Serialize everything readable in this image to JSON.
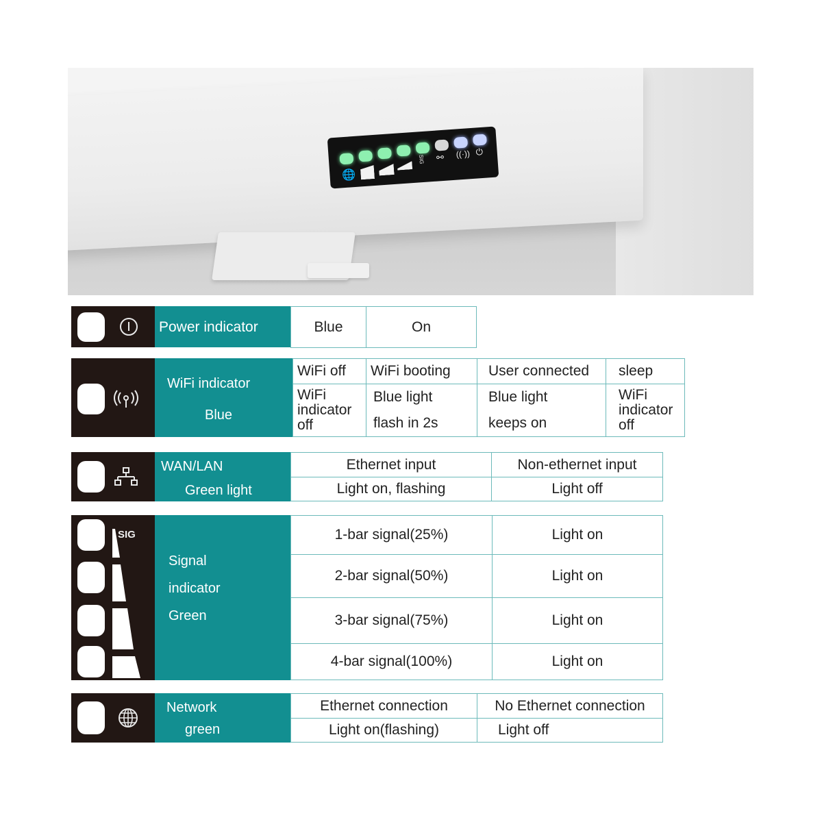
{
  "photo": {
    "led_panel": {
      "leds": [
        {
          "id": "network",
          "color": "green",
          "lit": true
        },
        {
          "id": "signal-4",
          "color": "green",
          "lit": true
        },
        {
          "id": "signal-3",
          "color": "green",
          "lit": true
        },
        {
          "id": "signal-2",
          "color": "green",
          "lit": true
        },
        {
          "id": "signal-1",
          "color": "green",
          "lit": true
        },
        {
          "id": "wan-lan",
          "color": "white",
          "lit": false
        },
        {
          "id": "wifi",
          "color": "blue",
          "lit": true
        },
        {
          "id": "power",
          "color": "blue",
          "lit": true
        }
      ],
      "sig_label": "SIG"
    }
  },
  "colors": {
    "teal": "#128f91",
    "dark": "#221714",
    "border": "#6cbaba"
  },
  "power": {
    "label": "Power indicator",
    "color": "Blue",
    "state": "On"
  },
  "wifi": {
    "label_line1": "WiFi indicator",
    "label_line2": "Blue",
    "headers": [
      "WiFi off",
      "WiFi booting",
      "User connected",
      "sleep"
    ],
    "values": [
      [
        "WiFi",
        "indicator",
        "off"
      ],
      [
        "Blue light",
        "flash in 2s"
      ],
      [
        "Blue light",
        "keeps on"
      ],
      [
        "WiFi",
        "indicator",
        "off"
      ]
    ]
  },
  "wanlan": {
    "label_line1": "WAN/LAN",
    "label_line2": "Green light",
    "headers": [
      "Ethernet input",
      "Non-ethernet input"
    ],
    "values": [
      "Light on, flashing",
      "Light off"
    ]
  },
  "signal": {
    "label_lines": [
      "Signal",
      "indicator",
      "Green"
    ],
    "sig_label": "SIG",
    "rows": [
      {
        "condition": "1-bar signal(25%)",
        "state": "Light on"
      },
      {
        "condition": "2-bar signal(50%)",
        "state": "Light on"
      },
      {
        "condition": "3-bar signal(75%)",
        "state": "Light on"
      },
      {
        "condition": "4-bar signal(100%)",
        "state": "Light on"
      }
    ]
  },
  "network": {
    "label_line1": "Network",
    "label_line2": "green",
    "headers": [
      "Ethernet connection",
      "No Ethernet connection"
    ],
    "values": [
      "Light on(flashing)",
      "Light off"
    ]
  }
}
